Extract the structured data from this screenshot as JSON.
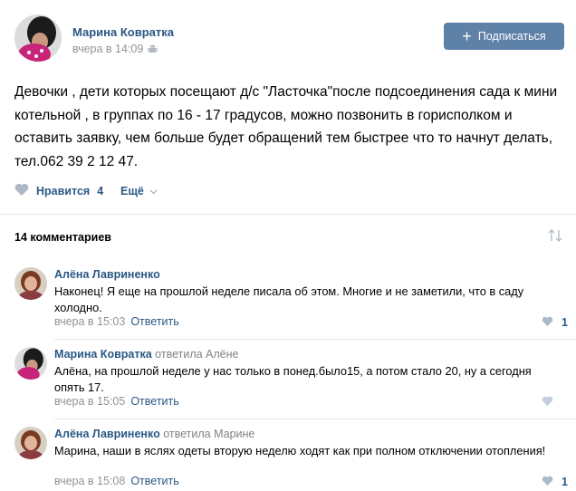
{
  "post": {
    "author": "Марина Ковратка",
    "time": "вчера в 14:09",
    "subscribe_label": "Подписаться",
    "text": "Девочки , дети которых посещают д/с \"Ласточка\"после подсоединения сада к мини котельной , в группах по 16 - 17 градусов, можно позвонить в горисполком и оставить заявку, чем больше будет обращений тем быстрее что то начнут делать, тел.062 39 2 12 47.",
    "likes_label": "Нравится",
    "likes_count": "4",
    "more_label": "Ещё"
  },
  "comments_header": "14 комментариев",
  "comments": [
    {
      "author": "Алёна Лавриненко",
      "reply_to": "",
      "text": "Наконец! Я еще на прошлой неделе писала об этом. Многие и не заметили, что в саду холодно.",
      "time": "вчера в 15:03",
      "reply_label": "Ответить",
      "likes": "1"
    },
    {
      "author": "Марина Ковратка",
      "reply_to": "ответила Алёне",
      "text": "Алёна, на прошлой неделе у нас только в понед.было15, а потом стало 20, ну а сегодня опять 17.",
      "time": "вчера в 15:05",
      "reply_label": "Ответить",
      "likes": ""
    },
    {
      "author": "Алёна Лавриненко",
      "reply_to": "ответила Марине",
      "text": "Марина, наши в яслях одеты вторую неделю ходят как при полном отключении отопления!",
      "time": "вчера в 15:08",
      "reply_label": "Ответить",
      "likes": "1"
    }
  ],
  "colors": {
    "link": "#2a5885",
    "button": "#5e81a8",
    "muted": "#939393",
    "like_heart": "#aeb9c7"
  }
}
